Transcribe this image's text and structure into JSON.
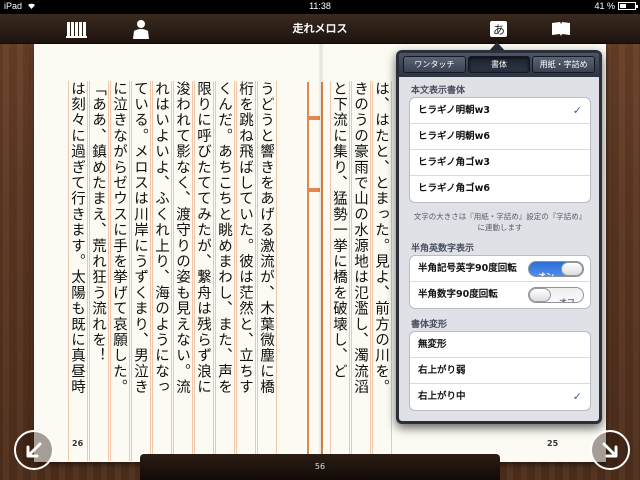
{
  "status_bar": {
    "device": "iPad",
    "time": "11:38",
    "battery": "41 %",
    "battery_level": 0.41
  },
  "toolbar": {
    "title": "走れメロス",
    "icons": [
      "bookshelf-icon",
      "author-icon",
      "font-settings-icon",
      "book-icon"
    ]
  },
  "book": {
    "left_page_number": "26",
    "right_page_number": "25",
    "progress_page": "56",
    "left_page_columns": [
      "うどうと響きをあげる激流が、木葉微塵に橋",
      "桁を跳ね飛ばしていた。彼は茫然と、立ちす",
      "くんだ。あちこちと眺めまわし、また、声を",
      "限りに呼びたててみたが、繋舟は残らず浪に",
      "浚われて影なく、渡守りの姿も見えない。流",
      "れはいよいよ、ふくれ上り、海のようになっ",
      "ている。メロスは川岸にうずくまり、男泣き",
      "に泣きながらゼウスに手を挙げて哀願した。",
      "「ああ、鎮めたまえ、荒れ狂う流れを！",
      "は刻々に過ぎて行きます。太陽も既に真昼時"
    ],
    "right_page_columns": [
      "は、はたと、とまった。見よ、前方の川を。",
      "きのうの豪雨で山の水源地は氾濫し、濁流滔",
      "と下流に集り、猛勢一挙に橋を破壊し、ど"
    ]
  },
  "popover": {
    "tabs": [
      "ワンタッチ",
      "書体",
      "用紙・字詰め"
    ],
    "active_tab": 1,
    "font_section_title": "本文表示書体",
    "fonts": [
      {
        "label": "ヒラギノ明朝w3",
        "checked": true
      },
      {
        "label": "ヒラギノ明朝w6",
        "checked": false
      },
      {
        "label": "ヒラギノ角ゴw3",
        "checked": false
      },
      {
        "label": "ヒラギノ角ゴw6",
        "checked": false
      }
    ],
    "font_note": "文字の大きさは『用紙・字詰め』設定の『字詰め』に連動します",
    "halfwidth_section_title": "半角英数字表示",
    "toggles": [
      {
        "label": "半角記号英字90度回転",
        "state": "オン",
        "on": true
      },
      {
        "label": "半角数字90度回転",
        "state": "オフ",
        "on": false
      }
    ],
    "transform_section_title": "書体変形",
    "transforms": [
      {
        "label": "無変形",
        "checked": false
      },
      {
        "label": "右上がり弱",
        "checked": false
      },
      {
        "label": "右上がり中",
        "checked": true
      }
    ],
    "check_mark": "✓"
  },
  "colors": {
    "wood": "#5c3722",
    "page": "#fbfaf3",
    "guide": "#e3874d",
    "accent_blue": "#2f6fd3"
  }
}
